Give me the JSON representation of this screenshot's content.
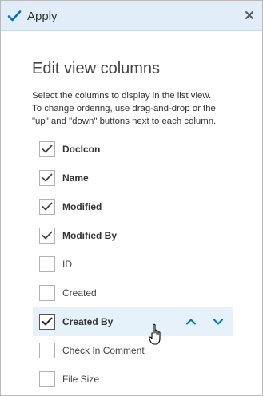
{
  "toolbar": {
    "apply_label": "Apply",
    "apply_icon": "checkmark-icon",
    "close_icon": "close-icon"
  },
  "panel": {
    "title": "Edit view columns",
    "description_lines": [
      "Select the columns to display in the list view.",
      "To change ordering, use drag-and-drop or the",
      "\"up\" and \"down\" buttons next to each column."
    ]
  },
  "columns": [
    {
      "label": "DocIcon",
      "checked": true
    },
    {
      "label": "Name",
      "checked": true
    },
    {
      "label": "Modified",
      "checked": true
    },
    {
      "label": "Modified By",
      "checked": true
    },
    {
      "label": "ID",
      "checked": false
    },
    {
      "label": "Created",
      "checked": false
    },
    {
      "label": "Created By",
      "checked": true,
      "selected": true,
      "move_up_icon": "chevron-up-icon",
      "move_down_icon": "chevron-down-icon"
    },
    {
      "label": "Check In Comment",
      "checked": false
    },
    {
      "label": "File Size",
      "checked": false
    }
  ],
  "colors": {
    "accent": "#0072c6",
    "toolbar_bg": "#e1edf8",
    "selected_row_bg": "#e6f2fa"
  }
}
